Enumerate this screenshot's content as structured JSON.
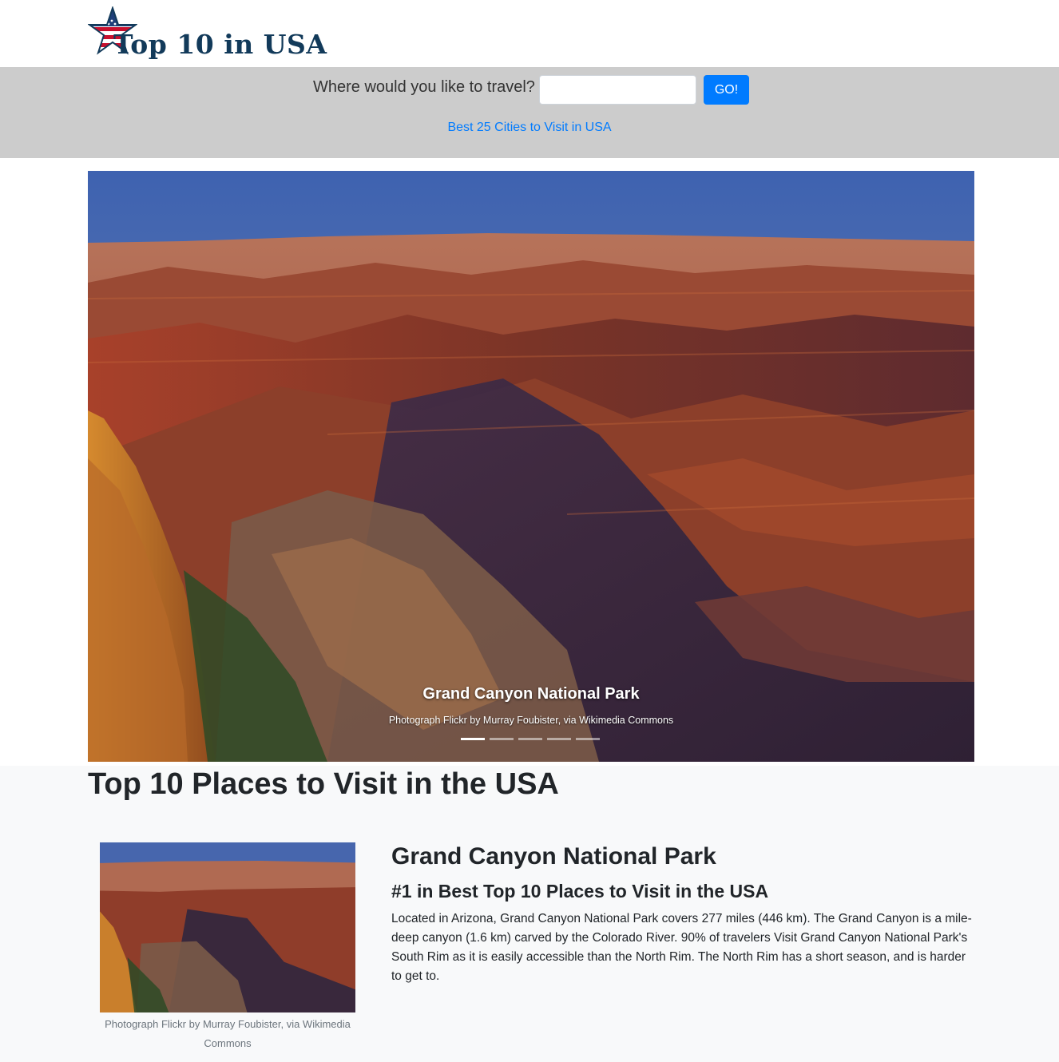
{
  "header": {
    "logo_text": "Top 10 in USA",
    "logo_icon": "star-flag-icon"
  },
  "search": {
    "label": "Where would you like to travel?",
    "value": "",
    "placeholder": "",
    "button_label": "GO!",
    "link_text": "Best 25 Cities to Visit in USA"
  },
  "carousel": {
    "caption_title": "Grand Canyon National Park",
    "caption_credit": "Photograph Flickr by Murray Foubister, via Wikimedia Commons",
    "slide_count": 5,
    "active_index": 0
  },
  "main": {
    "title": "Top 10 Places to Visit in the USA",
    "place": {
      "name": "Grand Canyon National Park",
      "rank": "#1 in Best Top 10 Places to Visit in the USA",
      "description": "Located in Arizona, Grand Canyon National Park covers 277 miles (446 km). The Grand Canyon is a mile-deep canyon (1.6 km) carved by the Colorado River. 90% of travelers Visit Grand Canyon National Park's South Rim as it is easily accessible than the North Rim. The North Rim has a short season, and is harder to get to.",
      "image_credit": "Photograph Flickr by Murray Foubister, via Wikimedia Commons"
    }
  },
  "colors": {
    "accent": "#007bff",
    "band": "#cccccc",
    "logo": "#123a5a",
    "section_bg": "#f8f9fa"
  }
}
